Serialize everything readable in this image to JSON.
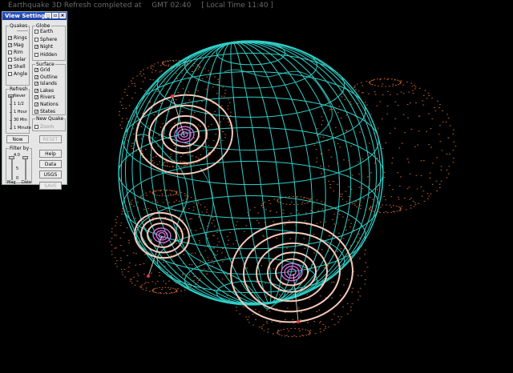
{
  "status_bar": {
    "title": "Earthquake 3D Refresh completed at",
    "gmt": "GMT 02:40",
    "local": "[ Local Time 11:40 ]"
  },
  "panel": {
    "title": "View Settings",
    "min_glyph": "_",
    "restore_glyph": "▫",
    "close_glyph": "×",
    "quakes": {
      "label": "Quakes",
      "items": [
        {
          "label": "Rings",
          "checked": true
        },
        {
          "label": "Mag",
          "checked": true
        },
        {
          "label": "Rim",
          "checked": false
        },
        {
          "label": "Solar",
          "checked": false
        },
        {
          "label": "Shell",
          "checked": true
        },
        {
          "label": "Angle",
          "checked": false
        }
      ]
    },
    "globe": {
      "label": "Globe",
      "items": [
        {
          "label": "Earth",
          "checked": false
        },
        {
          "label": "Sphere",
          "checked": false
        },
        {
          "label": "Night",
          "checked": true
        },
        {
          "label": "Hidden",
          "checked": false
        }
      ]
    },
    "surface": {
      "label": "Surface",
      "items": [
        {
          "label": "Grid",
          "checked": true
        },
        {
          "label": "Outline",
          "checked": true
        },
        {
          "label": "Islands",
          "checked": true
        },
        {
          "label": "Lakes",
          "checked": true
        },
        {
          "label": "Rivers",
          "checked": true
        },
        {
          "label": "Nations",
          "checked": true
        },
        {
          "label": "States",
          "checked": true
        }
      ]
    },
    "new_quake": {
      "label": "New Quake",
      "zoom": "Zoom",
      "zoom_checked": false
    },
    "refresh": {
      "label": "Refresh",
      "options": [
        "Never",
        "1 1/2",
        "1 Hour",
        "30 Min",
        "1 Minute"
      ],
      "selected_fraction": 0.0
    },
    "now_button": "Now",
    "reset_button": "RESET",
    "filter": {
      "label": "Filter by",
      "value": "4.0",
      "mag_label": "Mag",
      "date_label": "Date",
      "ticks": [
        "5",
        "0"
      ]
    },
    "help_button": "Help",
    "data_button": "Data",
    "usgs_button": "USGS",
    "save_button": "SAVE"
  },
  "colors": {
    "grid": "#2fd0c8",
    "dots": "#b25a28",
    "rings": "#f5c8b8",
    "core": "#d86ad8"
  }
}
